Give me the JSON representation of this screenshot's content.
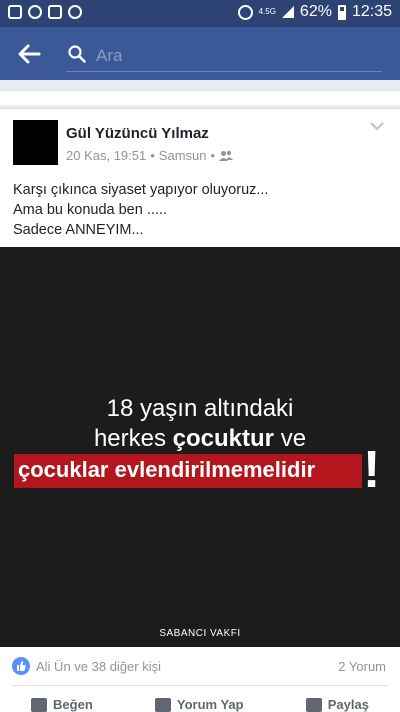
{
  "status_bar": {
    "network": "4.5G",
    "battery": "62%",
    "time": "12:35",
    "battery_level": 0.62
  },
  "top_bar": {
    "search_placeholder": "Ara"
  },
  "post": {
    "author": "Gül Yüzüncü Yılmaz",
    "date": "20 Kas, 19:51",
    "location": "Samsun",
    "separator": "•",
    "text_lines": [
      "Karşı çıkınca siyaset yapıyor oluyoruz...",
      "Ama bu konuda ben .....",
      "Sadece ANNEYIM..."
    ],
    "image": {
      "line1": "18 yaşın altındaki",
      "line2_prefix": "herkes",
      "line2_bold": "çocuktur",
      "line2_suffix": "ve",
      "line3": "çocuklar evlendirilmemelidir",
      "exclamation": "!",
      "brand": "SABANCI VAKFI"
    },
    "reactions": "Ali Ün ve 38 diğer kişi",
    "comments": "2 Yorum",
    "actions": {
      "like": "Beğen",
      "comment": "Yorum Yap",
      "share": "Paylaş"
    }
  },
  "colors": {
    "header": "#3b5998",
    "status": "#2d4373",
    "banner": "#b3171d"
  }
}
